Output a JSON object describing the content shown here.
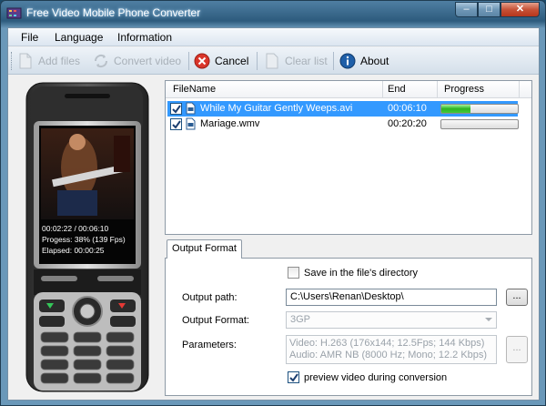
{
  "window": {
    "title": "Free Video Mobile Phone Converter",
    "caption": {
      "minimize": "–",
      "maximize": "□",
      "close": "✕"
    }
  },
  "menu": {
    "file": "File",
    "language": "Language",
    "information": "Information"
  },
  "toolbar": {
    "add_files": "Add files",
    "convert_video": "Convert video",
    "cancel": "Cancel",
    "clear_list": "Clear list",
    "about": "About"
  },
  "phone_screen": {
    "time": "00:02:22 / 00:06:10",
    "progress": "Progess: 38% (139 Fps)",
    "elapsed": "Elapsed: 00:00:25"
  },
  "file_list": {
    "columns": {
      "filename": "FileName",
      "end": "End",
      "progress": "Progress"
    },
    "rows": [
      {
        "filename": "While My Guitar Gently Weeps.avi",
        "end": "00:06:10",
        "progress": 0.38,
        "checked": true,
        "selected": true
      },
      {
        "filename": "Mariage.wmv",
        "end": "00:20:20",
        "progress": 0.0,
        "checked": true,
        "selected": false
      }
    ]
  },
  "output": {
    "tab_label": "Output Format",
    "save_in_dir_label": "Save in the file's directory",
    "save_in_dir_checked": false,
    "output_path_label": "Output path:",
    "output_path_value": "C:\\Users\\Renan\\Desktop\\",
    "browse_label": "...",
    "output_format_label": "Output Format:",
    "output_format_value": "3GP",
    "parameters_label": "Parameters:",
    "parameters_video": "Video: H.263 (176x144; 12.5Fps; 144 Kbps)",
    "parameters_audio": "Audio: AMR NB (8000 Hz; Mono; 12.2 Kbps)",
    "params_button_label": "...",
    "preview_label": "preview video during conversion",
    "preview_checked": true
  },
  "colors": {
    "selection": "#3399ff",
    "progress_green": "#2bb523",
    "cancel_red": "#d9352a",
    "about_blue": "#1f5fa8"
  }
}
